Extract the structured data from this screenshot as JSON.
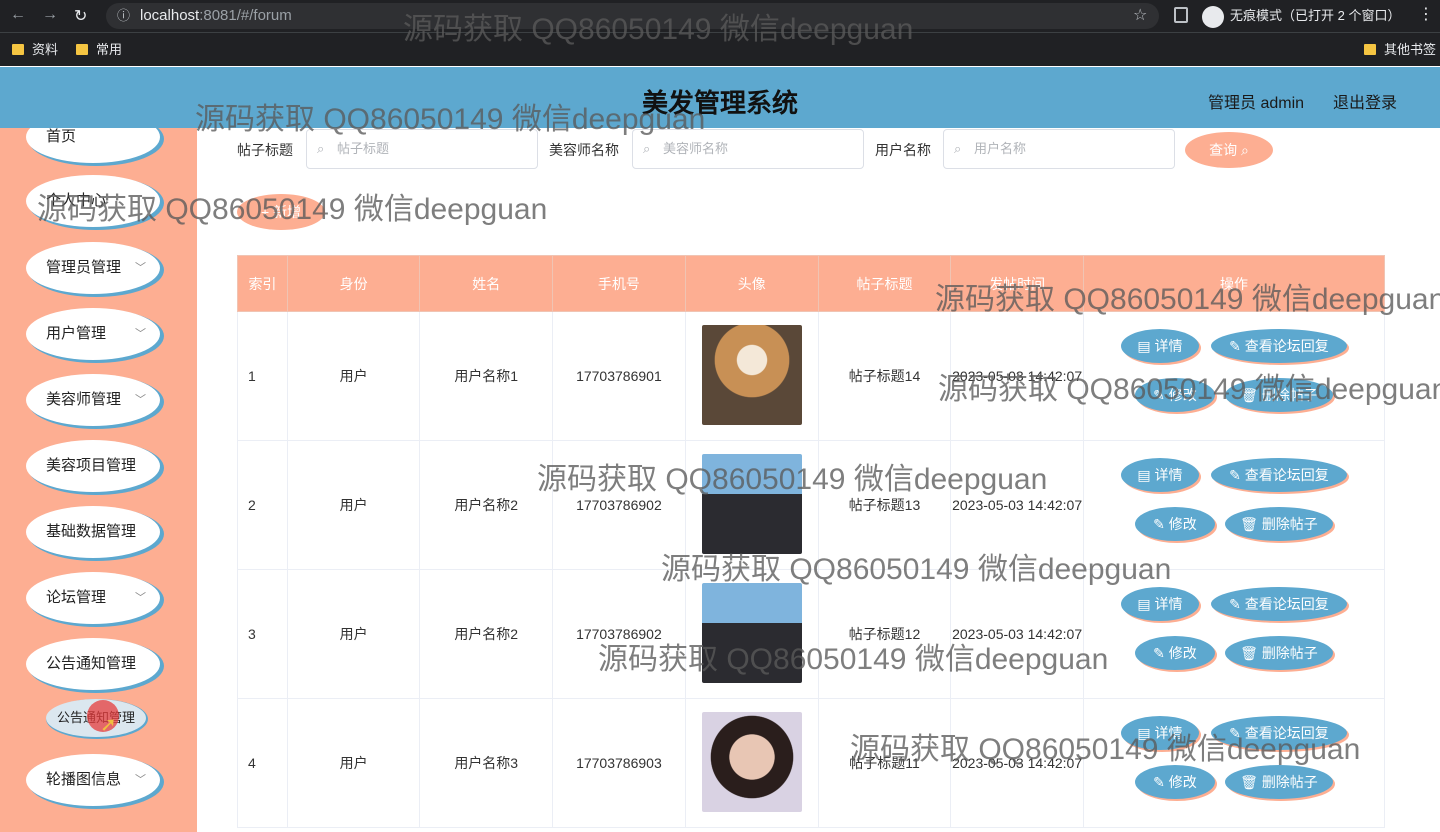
{
  "browser": {
    "url_host": "localhost",
    "url_rest": ":8081/#/forum",
    "incognito_label": "无痕模式（已打开 2 个窗口）",
    "bookmarks": [
      "资料",
      "常用"
    ],
    "other_bookmarks": "其他书签"
  },
  "header": {
    "title": "美发管理系统",
    "admin": "管理员 admin",
    "logout": "退出登录"
  },
  "sidebar": {
    "items": [
      {
        "label": "首页"
      },
      {
        "label": "个人中心"
      },
      {
        "label": "管理员管理"
      },
      {
        "label": "用户管理"
      },
      {
        "label": "美容师管理"
      },
      {
        "label": "美容项目管理"
      },
      {
        "label": "基础数据管理"
      },
      {
        "label": "论坛管理"
      },
      {
        "label": "公告通知管理"
      },
      {
        "label": "轮播图信息"
      }
    ],
    "submenu": "公告通知管理"
  },
  "search": {
    "title_label": "帖子标题",
    "title_placeholder": "帖子标题",
    "beautician_label": "美容师名称",
    "beautician_placeholder": "美容师名称",
    "user_label": "用户名称",
    "user_placeholder": "用户名称",
    "query_button": "查询",
    "add_button": "+ 新增"
  },
  "table": {
    "headers": [
      "索引",
      "身份",
      "姓名",
      "手机号",
      "头像",
      "帖子标题",
      "发帖时间",
      "操作"
    ],
    "rows": [
      {
        "idx": "1",
        "role": "用户",
        "name": "用户名称1",
        "phone": "17703786901",
        "title": "帖子标题14",
        "time": "2023-05-03 14:42:07"
      },
      {
        "idx": "2",
        "role": "用户",
        "name": "用户名称2",
        "phone": "17703786902",
        "title": "帖子标题13",
        "time": "2023-05-03 14:42:07"
      },
      {
        "idx": "3",
        "role": "用户",
        "name": "用户名称2",
        "phone": "17703786902",
        "title": "帖子标题12",
        "time": "2023-05-03 14:42:07"
      },
      {
        "idx": "4",
        "role": "用户",
        "name": "用户名称3",
        "phone": "17703786903",
        "title": "帖子标题11",
        "time": "2023-05-03 14:42:07"
      }
    ],
    "actions": {
      "detail": "详情",
      "view_replies": "查看论坛回复",
      "edit": "修改",
      "delete": "删除帖子"
    }
  },
  "watermark": "源码获取 QQ86050149 微信deepguan"
}
